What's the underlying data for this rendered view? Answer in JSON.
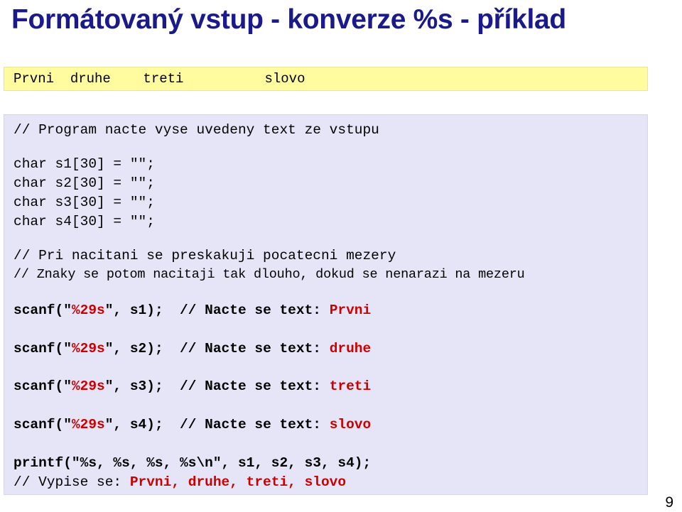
{
  "slide": {
    "title": "Formátovaný vstup - konverze %s - příklad",
    "title_color": "#1a1a8c",
    "page_number": "9"
  },
  "output_box": {
    "background_color": "#fffb9e",
    "text": "Prvni  druhe    treti          slovo"
  },
  "code_box": {
    "background_color": "#e5e5f7",
    "accent_color": "#cc0000",
    "lines": [
      {
        "id": "comment-read-input",
        "text": "// Program nacte vyse uvedeny text ze vstupu"
      },
      {
        "id": "decl-s1",
        "text": "char s1[30] = \"\";"
      },
      {
        "id": "decl-s2",
        "text": "char s2[30] = \"\";"
      },
      {
        "id": "decl-s3",
        "text": "char s3[30] = \"\";"
      },
      {
        "id": "decl-s4",
        "text": "char s4[30] = \"\";"
      },
      {
        "id": "comment-skip-spaces",
        "text": "// Pri nacitani se preskakuji pocatecni mezery"
      },
      {
        "id": "comment-read-until-space",
        "text": "// Znaky se potom nacitaji tak dlouho, dokud se nenarazi na mezeru"
      },
      {
        "id": "scanf-s1",
        "prefix": "scanf(\"",
        "spec": "%29s",
        "suffix": "\", s1);  // Nacte se text: ",
        "result": "Prvni"
      },
      {
        "id": "scanf-s2",
        "prefix": "scanf(\"",
        "spec": "%29s",
        "suffix": "\", s2);  // Nacte se text: ",
        "result": "druhe"
      },
      {
        "id": "scanf-s3",
        "prefix": "scanf(\"",
        "spec": "%29s",
        "suffix": "\", s3);  // Nacte se text: ",
        "result": "treti"
      },
      {
        "id": "scanf-s4",
        "prefix": "scanf(\"",
        "spec": "%29s",
        "suffix": "\", s4);  // Nacte se text: ",
        "result": "slovo"
      },
      {
        "id": "printf-all",
        "text": "printf(\"%s, %s, %s, %s\\n\", s1, s2, s3, s4);"
      },
      {
        "id": "comment-output",
        "prefix": "// Vypise se: ",
        "result": "Prvni, druhe, treti, slovo"
      }
    ]
  }
}
